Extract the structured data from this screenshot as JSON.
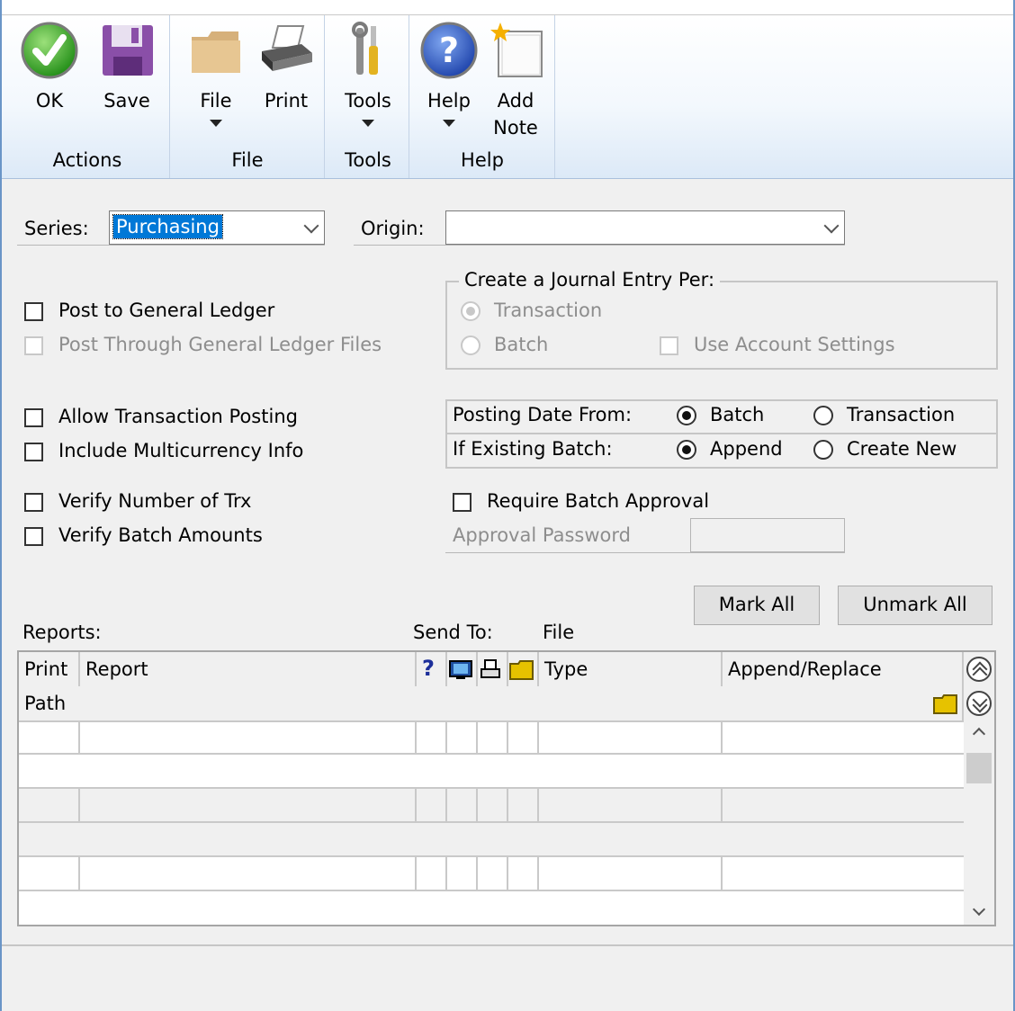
{
  "ribbon": {
    "ok_label": "OK",
    "save_label": "Save",
    "file_label": "File",
    "print_label": "Print",
    "tools_label": "Tools",
    "help_label": "Help",
    "add_note_label1": "Add",
    "add_note_label2": "Note",
    "groups": {
      "actions": "Actions",
      "file": "File",
      "tools": "Tools",
      "help": "Help"
    }
  },
  "form": {
    "series_label": "Series:",
    "series_value": "Purchasing",
    "origin_label": "Origin:",
    "origin_value": "",
    "post_to_gl": "Post to General Ledger",
    "post_through_gl_files": "Post Through General Ledger Files",
    "journal_group_title": "Create a Journal Entry Per:",
    "journal_transaction": "Transaction",
    "journal_batch": "Batch",
    "use_account_settings": "Use Account Settings",
    "allow_transaction_posting": "Allow Transaction Posting",
    "include_multicurrency": "Include Multicurrency Info",
    "posting_date_from": "Posting Date From:",
    "posting_batch": "Batch",
    "posting_transaction": "Transaction",
    "if_existing_batch": "If Existing Batch:",
    "existing_append": "Append",
    "existing_create_new": "Create New",
    "verify_number_trx": "Verify Number of Trx",
    "verify_batch_amounts": "Verify Batch Amounts",
    "require_batch_approval": "Require Batch Approval",
    "approval_password": "Approval Password",
    "mark_all": "Mark All",
    "unmark_all": "Unmark All"
  },
  "reports": {
    "reports_label": "Reports:",
    "send_to_label": "Send To:",
    "file_label": "File",
    "columns": {
      "print": "Print",
      "report": "Report",
      "help": "?",
      "type": "Type",
      "append_replace": "Append/Replace",
      "path": "Path"
    }
  },
  "colors": {
    "selection": "#0078d7",
    "ribbon_border": "#a9c0dc"
  }
}
